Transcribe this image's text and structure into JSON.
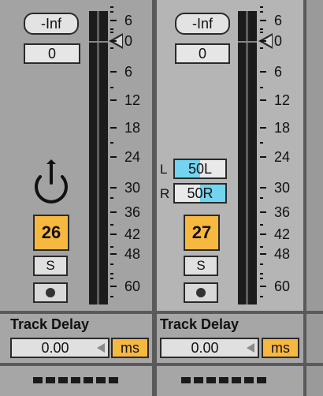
{
  "scale_labels": [
    "6",
    "0",
    "6",
    "12",
    "18",
    "24",
    "30",
    "36",
    "42",
    "48",
    "60"
  ],
  "tracks": [
    {
      "volume_peak": "-Inf",
      "volume_value": "0",
      "track_number": "26",
      "solo_label": "S",
      "pan_mode": "knob",
      "track_delay_label": "Track Delay",
      "track_delay_value": "0.00",
      "track_delay_unit": "ms"
    },
    {
      "volume_peak": "-Inf",
      "volume_value": "0",
      "track_number": "27",
      "solo_label": "S",
      "pan_mode": "split",
      "pan_left_label": "L",
      "pan_left_value": "50L",
      "pan_left_fill": 0.5,
      "pan_right_label": "R",
      "pan_right_value": "50R",
      "pan_right_fill": 0.5,
      "track_delay_label": "Track Delay",
      "track_delay_value": "0.00",
      "track_delay_unit": "ms"
    }
  ],
  "colors": {
    "track_number_bg": "#f7b840",
    "pan_fill": "#72d4ef",
    "panel_bg": "#a3a3a3",
    "selected_panel_bg": "#b5b5b5"
  }
}
